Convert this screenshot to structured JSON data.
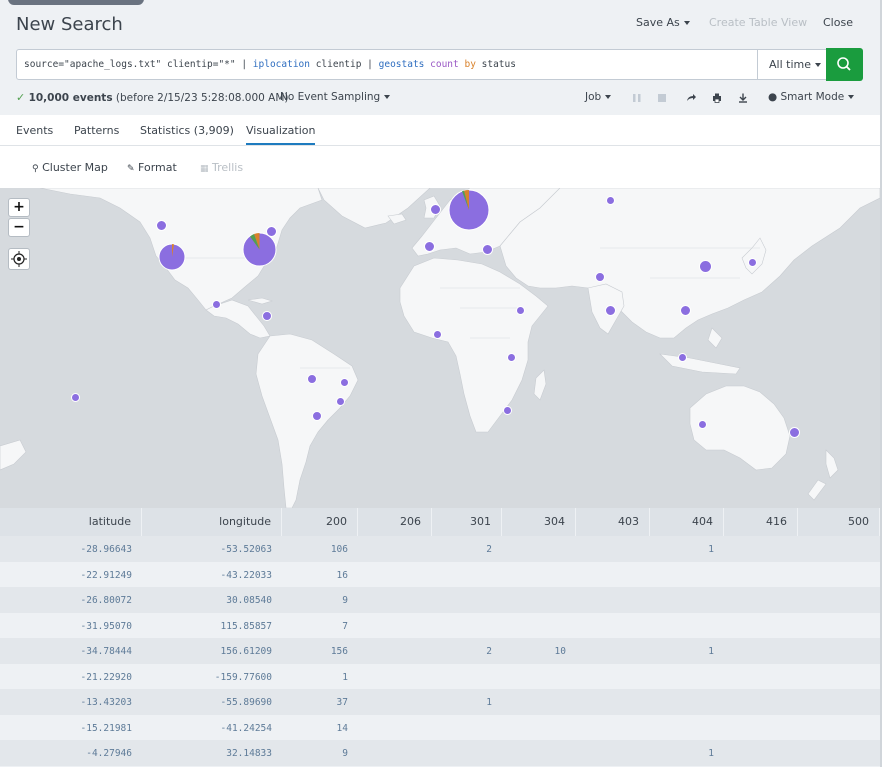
{
  "header": {
    "title": "New Search",
    "save_as": "Save As",
    "create_table_view": "Create Table View",
    "close": "Close"
  },
  "search": {
    "query_parts": [
      {
        "text": "source=\"apache_logs.txt\" clientip=\"*\" | ",
        "style": "plain"
      },
      {
        "text": "iplocation",
        "style": "kw"
      },
      {
        "text": " clientip | ",
        "style": "plain"
      },
      {
        "text": "geostats",
        "style": "kw"
      },
      {
        "text": " ",
        "style": "plain"
      },
      {
        "text": "count",
        "style": "cmd"
      },
      {
        "text": " ",
        "style": "plain"
      },
      {
        "text": "by",
        "style": "arg"
      },
      {
        "text": " status",
        "style": "plain"
      }
    ],
    "time_range": "All time"
  },
  "status": {
    "event_count": "10,000 events",
    "event_detail": "(before 2/15/23 5:28:08.000 AM)",
    "sampling": "No Event Sampling",
    "job": "Job",
    "mode": "Smart Mode"
  },
  "tabs": [
    {
      "label": "Events",
      "active": false
    },
    {
      "label": "Patterns",
      "active": false
    },
    {
      "label": "Statistics (3,909)",
      "active": false
    },
    {
      "label": "Visualization",
      "active": true
    }
  ],
  "viz_toolbar": {
    "cluster_map": "Cluster Map",
    "format": "Format",
    "trellis": "Trellis"
  },
  "map_controls": {
    "zoom_in": "+",
    "zoom_out": "−"
  },
  "colors": {
    "marker": "#8b6ee0",
    "slice_orange": "#d9822b",
    "slice_green": "#53a051",
    "accent": "#1a9c3e"
  },
  "table": {
    "columns": [
      "latitude",
      "longitude",
      "200",
      "206",
      "301",
      "304",
      "403",
      "404",
      "416",
      "500"
    ],
    "rows": [
      [
        "-28.96643",
        "-53.52063",
        "106",
        "",
        "2",
        "",
        "",
        "1",
        "",
        ""
      ],
      [
        "-22.91249",
        "-43.22033",
        "16",
        "",
        "",
        "",
        "",
        "",
        "",
        ""
      ],
      [
        "-26.80072",
        "30.08540",
        "9",
        "",
        "",
        "",
        "",
        "",
        "",
        ""
      ],
      [
        "-31.95070",
        "115.85857",
        "7",
        "",
        "",
        "",
        "",
        "",
        "",
        ""
      ],
      [
        "-34.78444",
        "156.61209",
        "156",
        "",
        "2",
        "10",
        "",
        "1",
        "",
        ""
      ],
      [
        "-21.22920",
        "-159.77600",
        "1",
        "",
        "",
        "",
        "",
        "",
        "",
        ""
      ],
      [
        "-13.43203",
        "-55.89690",
        "37",
        "",
        "1",
        "",
        "",
        "",
        "",
        ""
      ],
      [
        "-15.21981",
        "-41.24254",
        "14",
        "",
        "",
        "",
        "",
        "",
        "",
        ""
      ],
      [
        "-4.27946",
        "32.14833",
        "9",
        "",
        "",
        "",
        "",
        "1",
        "",
        ""
      ]
    ]
  }
}
